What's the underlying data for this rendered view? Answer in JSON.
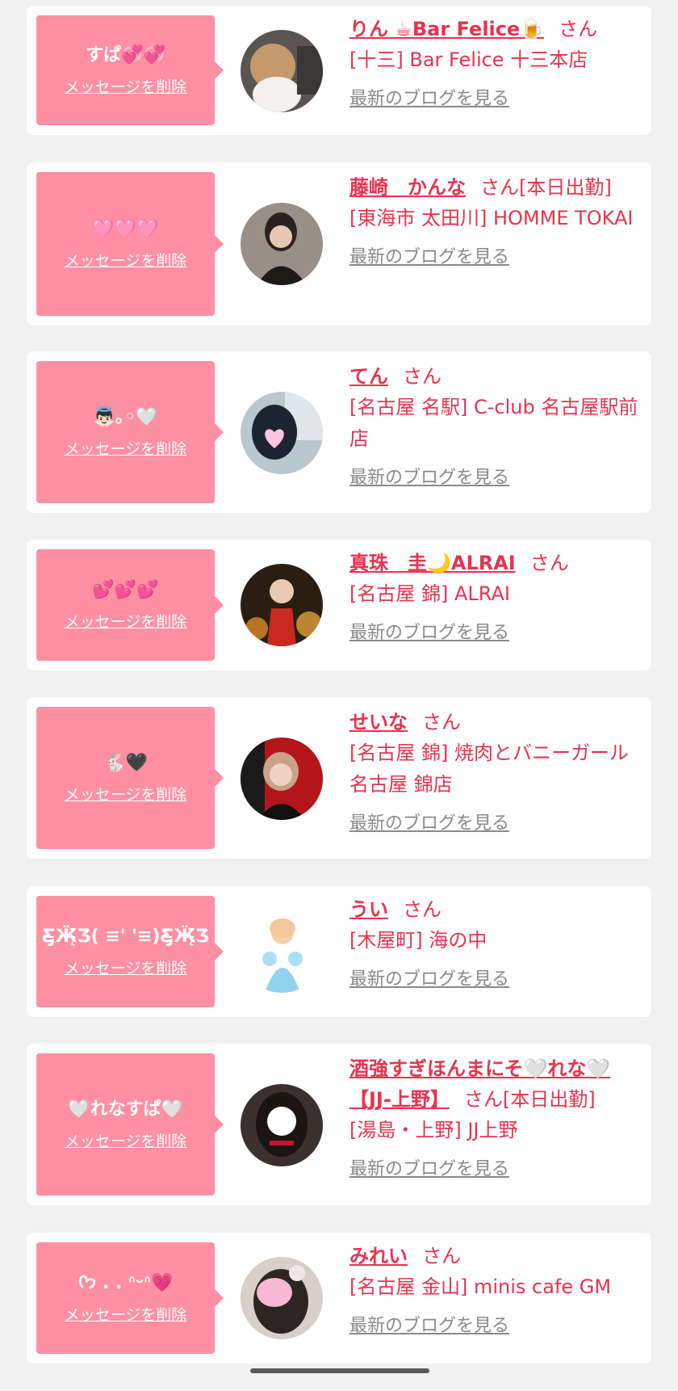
{
  "colors": {
    "accent": "#e8334f",
    "bubble": "#ff8fa3",
    "link_gray": "#8a8a8a",
    "background": "#f1f1f1"
  },
  "delete_label": "メッセージを削除",
  "blog_label": "最新のブログを見る",
  "cards": [
    {
      "message": "すぱ💞💞",
      "name": "りん ☕Bar Felice🍺",
      "suffix": "さん",
      "shop": "[十三] Bar Felice 十三本店"
    },
    {
      "message": "🩷🩷🩷",
      "name": "藤崎　かんな",
      "suffix": "さん[本日出勤]",
      "shop": "[東海市 太田川] HOMME TOKAI"
    },
    {
      "message": "👼🏻｡◦🤍",
      "name": "てん",
      "suffix": "さん",
      "shop": "[名古屋 名駅] C-club 名古屋駅前店"
    },
    {
      "message": "💕💕💕",
      "name": "真珠　圭🌙ALRAI",
      "suffix": "さん",
      "shop": "[名古屋 錦] ALRAI"
    },
    {
      "message": "🐇🖤",
      "name": "せいな",
      "suffix": "さん",
      "shop": "[名古屋 錦] 焼肉とバニーガール 名古屋 錦店"
    },
    {
      "message": "Ƹ̵̡Ӝ̵̨̄Ʒ( ≡' '≡)Ƹ̵̡Ӝ̵̨̄Ʒ",
      "name": "うい",
      "suffix": "さん",
      "shop": "[木屋町] 海の中"
    },
    {
      "message": "🤍れなすぱ🤍",
      "name": "酒強すぎほんまにそ🤍れな🤍【JJ-上野】",
      "suffix": "さん[本日出勤]",
      "shop": "[湯島・上野] JJ上野"
    },
    {
      "message": "ᢉ𐭩 . . ᐢᵕᐢ💗",
      "name": "みれい",
      "suffix": "さん",
      "shop": "[名古屋 金山] minis cafe GM"
    }
  ]
}
